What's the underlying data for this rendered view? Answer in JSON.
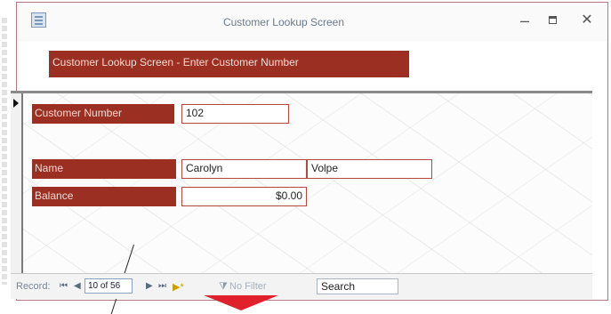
{
  "window": {
    "title": "Customer Lookup Screen",
    "controls": {
      "minimize": "–",
      "close": "✕"
    }
  },
  "form": {
    "header_banner": "Customer Lookup Screen - Enter Customer Number",
    "customer_number": {
      "label": "Customer Number",
      "value": "102"
    },
    "name": {
      "label": "Name",
      "first": "Carolyn",
      "last": "Volpe"
    },
    "balance": {
      "label": "Balance",
      "value": "$0.00"
    }
  },
  "navigation": {
    "record_label": "Record:",
    "first": "⏮",
    "prev": "◀",
    "current": "10 of 56",
    "next": "▶",
    "last": "⏭",
    "new": "▶*",
    "filter_icon": "funnel-icon",
    "filter_label": "No Filter",
    "search_placeholder": "Search"
  },
  "colors": {
    "label_bg": "#9b2f22",
    "field_border": "#b04a40",
    "arrow": "#e0202a"
  }
}
